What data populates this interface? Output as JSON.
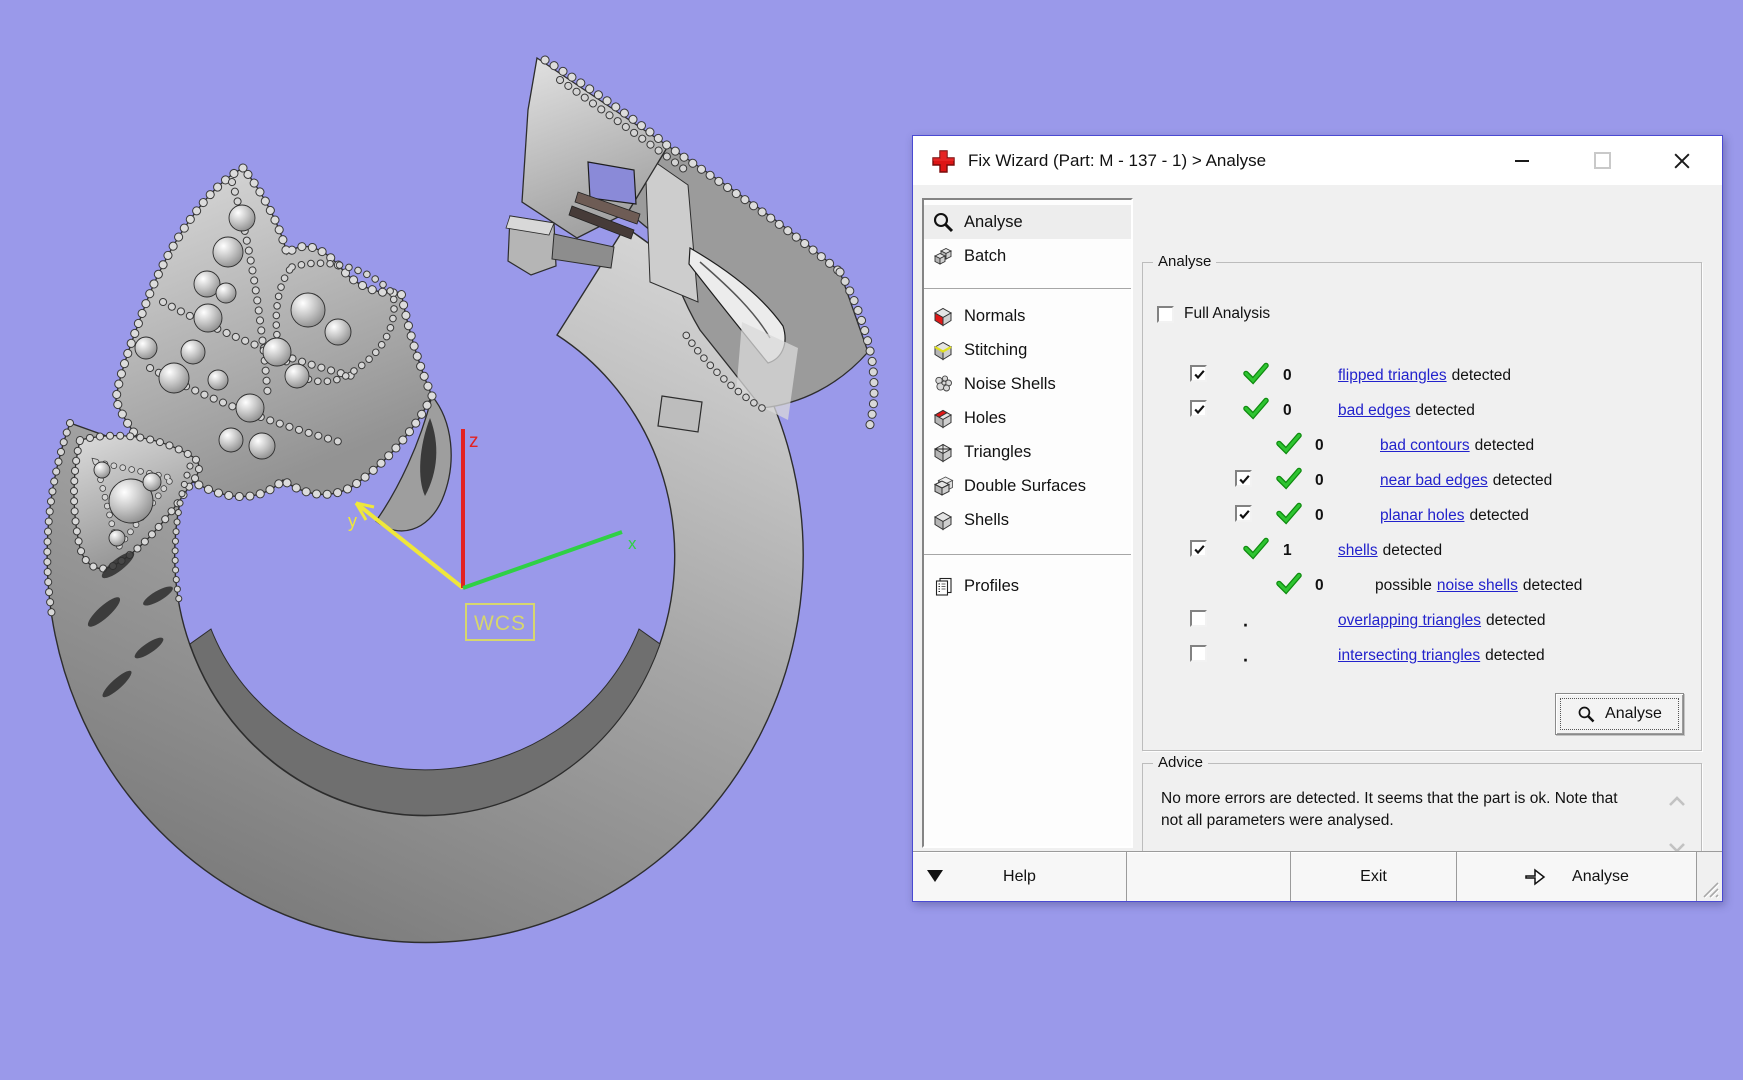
{
  "colors": {
    "viewport-bg": "#9a99ea",
    "window-border": "#4a4ad2",
    "titlebar-bg": "#ffffff",
    "dialog-bg": "#f0f0f0",
    "link": "#2222cc",
    "check-green": "#1fb224",
    "axis-x": "#2fd045",
    "axis-y": "#efe73a",
    "axis-z": "#e32222",
    "wcs-yellow": "#d6d66e",
    "model-gray": "#a9a9a9"
  },
  "viewport": {
    "model_description": "open jewelry ring with beaded crown ornaments, gray shaded CAD render",
    "axes": {
      "x": "x",
      "y": "y",
      "z": "z"
    },
    "origin_label": "WCS"
  },
  "window": {
    "title": "Fix Wizard (Part: M - 137 - 1) > Analyse",
    "app_icon": "red-cross-icon",
    "controls": [
      {
        "name": "minimize"
      },
      {
        "name": "maximize",
        "disabled": true
      },
      {
        "name": "close"
      }
    ]
  },
  "sidebar": {
    "groups": [
      {
        "items": [
          {
            "label": "Analyse",
            "icon": "magnifier-icon",
            "selected": true
          },
          {
            "label": "Batch",
            "icon": "batch-cubes-icon"
          }
        ]
      },
      {
        "items": [
          {
            "label": "Normals",
            "icon": "normals-cube-icon"
          },
          {
            "label": "Stitching",
            "icon": "stitching-cube-icon"
          },
          {
            "label": "Noise Shells",
            "icon": "noise-shells-icon"
          },
          {
            "label": "Holes",
            "icon": "holes-cube-icon"
          },
          {
            "label": "Triangles",
            "icon": "triangles-cube-icon"
          },
          {
            "label": "Double Surfaces",
            "icon": "double-surfaces-icon"
          },
          {
            "label": "Shells",
            "icon": "shells-cube-icon"
          }
        ]
      },
      {
        "items": [
          {
            "label": "Profiles",
            "icon": "profiles-icon"
          }
        ]
      }
    ]
  },
  "analyse_panel": {
    "group_title": "Analyse",
    "full_analysis": {
      "label": "Full Analysis",
      "checked": false
    },
    "rows": [
      {
        "indent": 0,
        "has_checkbox": true,
        "checked": true,
        "result": true,
        "count": "0",
        "link": "flipped triangles",
        "suffix": "detected"
      },
      {
        "indent": 0,
        "has_checkbox": true,
        "checked": true,
        "result": true,
        "count": "0",
        "link": "bad edges",
        "suffix": "detected"
      },
      {
        "indent": 1,
        "has_checkbox": false,
        "checked": null,
        "result": true,
        "count": "0",
        "link": "bad contours",
        "suffix": "detected"
      },
      {
        "indent": 1,
        "has_checkbox": true,
        "checked": true,
        "result": true,
        "count": "0",
        "link": "near bad edges",
        "suffix": "detected"
      },
      {
        "indent": 1,
        "has_checkbox": true,
        "checked": true,
        "result": true,
        "count": "0",
        "link": "planar holes",
        "suffix": "detected"
      },
      {
        "indent": 0,
        "has_checkbox": true,
        "checked": true,
        "result": true,
        "count": "1",
        "link": "shells",
        "suffix": "detected"
      },
      {
        "indent": 1,
        "has_checkbox": false,
        "checked": null,
        "result": true,
        "count": "0",
        "prefix": "possible",
        "link": "noise shells",
        "suffix": "detected"
      },
      {
        "indent": 0,
        "has_checkbox": true,
        "checked": false,
        "result": false,
        "count": ".",
        "link": "overlapping triangles",
        "suffix": "detected"
      },
      {
        "indent": 0,
        "has_checkbox": true,
        "checked": false,
        "result": false,
        "count": ".",
        "link": "intersecting triangles",
        "suffix": "detected"
      }
    ],
    "analyse_button": {
      "label": "Analyse",
      "icon": "magnifier-icon"
    }
  },
  "advice_panel": {
    "group_title": "Advice",
    "text": "No more errors are detected. It seems that the part is ok. Note that not all parameters were analysed."
  },
  "footer": {
    "menu_icon": "dropdown-triangle-icon",
    "help_label": "Help",
    "exit_label": "Exit",
    "next_label": "Analyse",
    "next_icon": "arrow-right-icon"
  }
}
